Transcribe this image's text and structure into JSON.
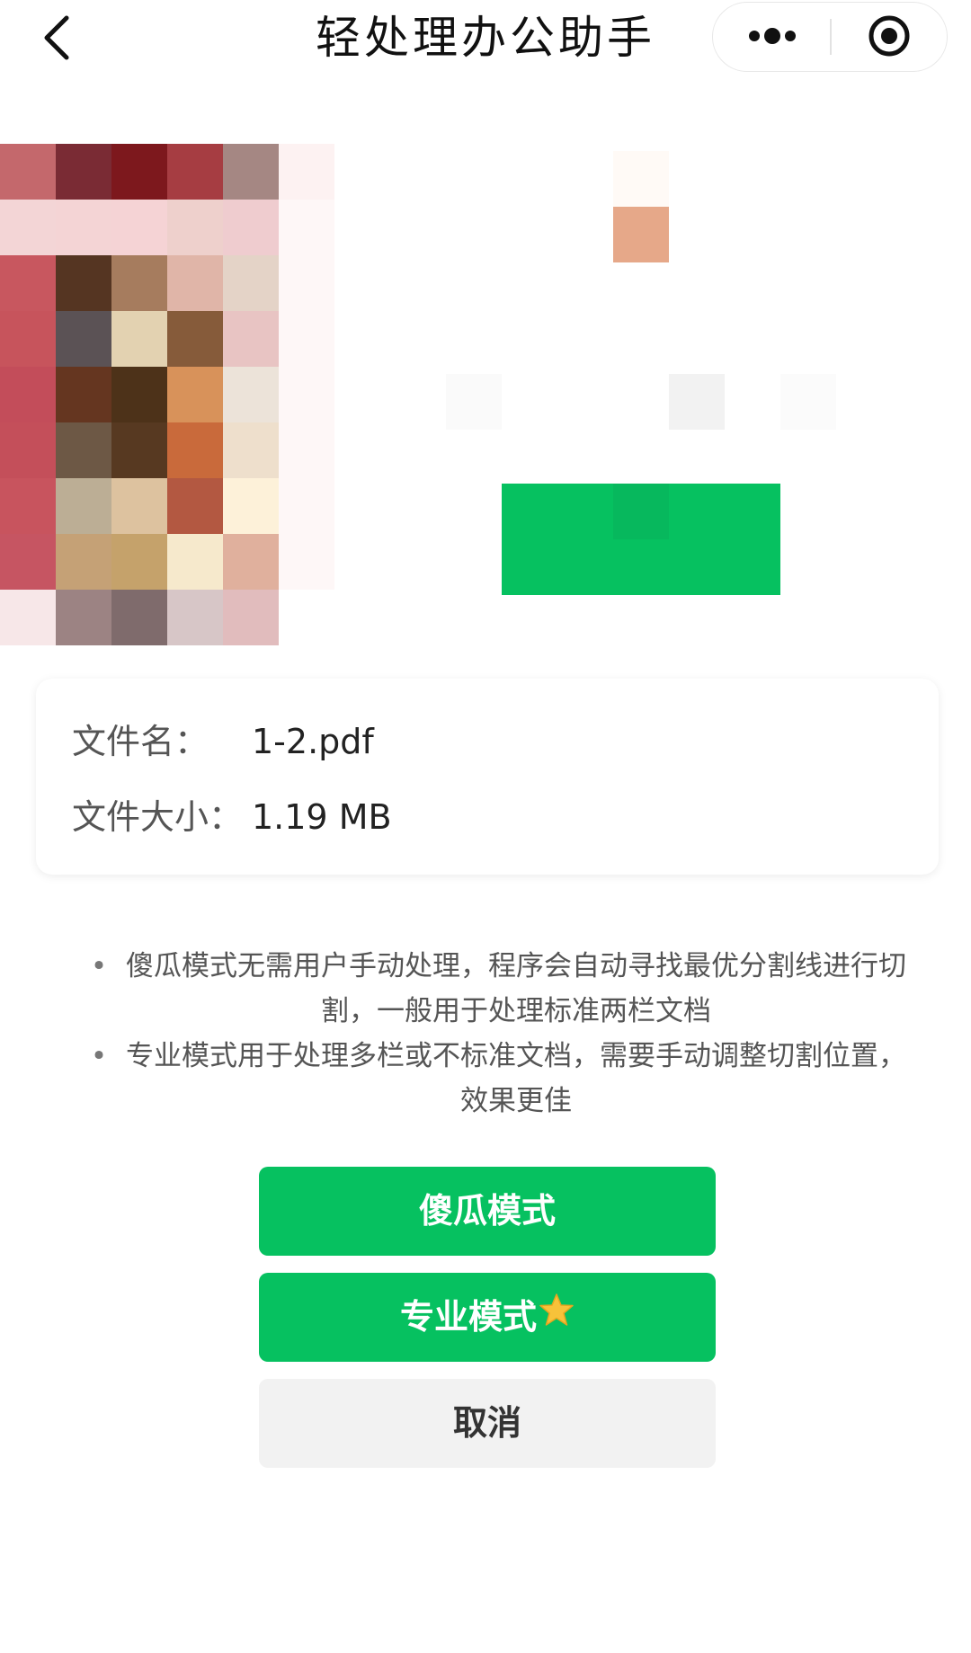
{
  "navbar": {
    "title": "轻处理办公助手",
    "back_icon": "chevron-left-icon",
    "more_icon": "more-dots-icon",
    "close_icon": "record-target-icon"
  },
  "preview": {
    "description_icon": "pixelated-document-thumbnail",
    "mosaic_colors": [
      [
        "#c4686c",
        "#7a2b34",
        "#7d181d",
        "#a63d42",
        "#a58783",
        "#fdf2f2"
      ],
      [
        "#f3d5d6",
        "#f4d4d5",
        "#f5d3d5",
        "#eed0cc",
        "#efcccf",
        "#fef7f7"
      ],
      [
        "#c8575f",
        "#553522",
        "#a67c5e",
        "#e0b5a8",
        "#e4d3c7",
        "#fef7f7"
      ],
      [
        "#c7545c",
        "#5b5255",
        "#e3d2b1",
        "#865b3a",
        "#e8c4c3",
        "#fef7f7"
      ],
      [
        "#c34d5a",
        "#653620",
        "#4d3219",
        "#d8925a",
        "#ece3d9",
        "#fef7f7"
      ],
      [
        "#c44f5a",
        "#6d5845",
        "#573921",
        "#c96a3b",
        "#eedfcc",
        "#fef7f7"
      ],
      [
        "#c8545e",
        "#bcae95",
        "#ddc29f",
        "#b35841",
        "#fdf1d9",
        "#fef7f7"
      ],
      [
        "#c65562",
        "#c5a176",
        "#c5a26b",
        "#f6e9cc",
        "#e0b09d",
        "#fef7f7"
      ],
      [
        "#f7e7e8",
        "#9c8383",
        "#7f6b6c",
        "#d7c6c7",
        "#e1bcbd",
        "#ffffff"
      ]
    ],
    "accent_orange": "#e6a889",
    "green": "#06c160"
  },
  "file_info": {
    "name_label": "文件名：",
    "name_value": "1-2.pdf",
    "size_label": "文件大小：",
    "size_value": "1.19 MB"
  },
  "description": {
    "bullet": "•",
    "item_1": "傻瓜模式无需用户手动处理，程序会自动寻找最优分割线进行切割，一般用于处理标准两栏文档",
    "item_2": "专业模式用于处理多栏或不标准文档，需要手动调整切割位置，效果更佳"
  },
  "buttons": {
    "fool_mode": "傻瓜模式",
    "pro_mode": "专业模式",
    "pro_mode_icon": "star-icon",
    "cancel": "取消"
  },
  "colors": {
    "primary_green": "#06c160",
    "cancel_bg": "#f2f2f2",
    "star": "#f7c23a"
  }
}
